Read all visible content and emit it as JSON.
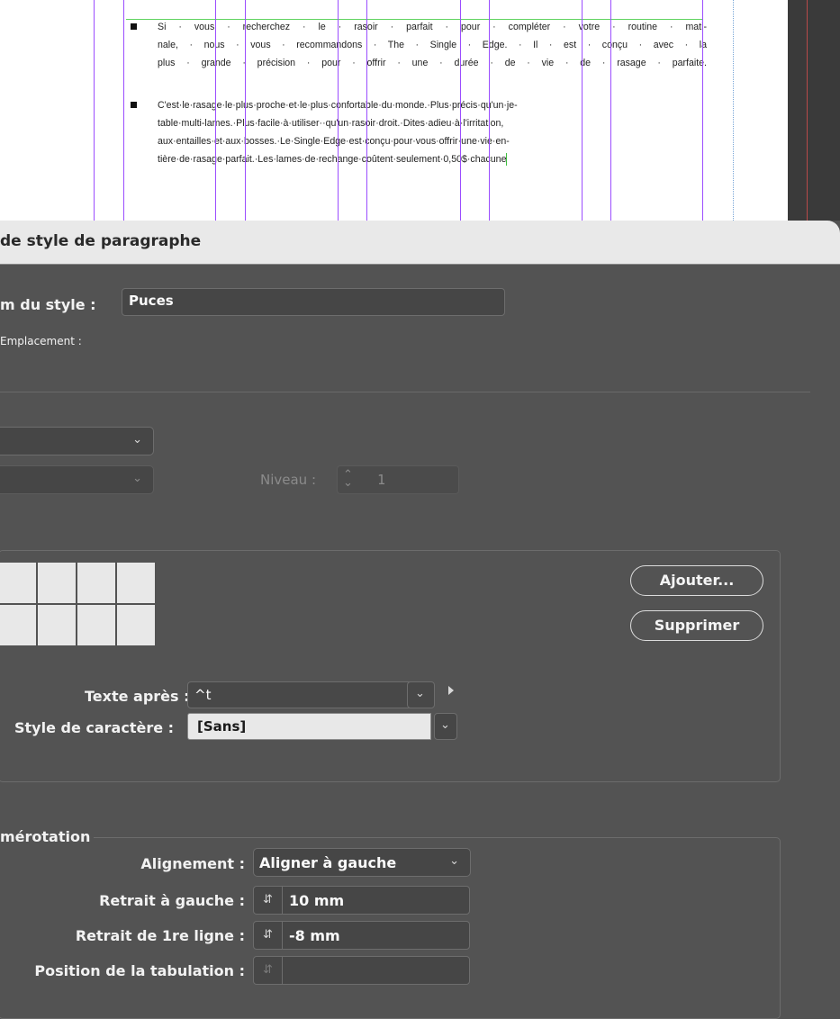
{
  "document": {
    "bullet_paragraphs": [
      {
        "lines": [
          "Si · vous · recherchez · le · rasoir · parfait · pour · compléter · votre · routine · mati-",
          "nale, · nous · vous · recommandons · The · Single · Edge. · Il · est · conçu · avec · la",
          "plus · grande · précision · pour · offrir · une · durée · de · vie · de · rasage · parfaite."
        ]
      },
      {
        "lines": [
          "C'est·le·rasage·le·plus·proche·et·le·plus·confortable·du·monde.·Plus·précis·qu'un·je-",
          "table·multi-lames.·Plus·facile·à·utiliser··qu'un·rasoir·droit.·Dites·adieu·à·l'irritation,",
          "aux·entailles·et·aux·bosses.·Le·Single·Edge·est·conçu·pour·vous·offrir·une·vie·en-",
          "tière·de·rasage·parfait.·Les·lames·de·rechange·coûtent·seulement·0,50$·chacune"
        ]
      }
    ]
  },
  "dialog": {
    "title": "de style de paragraphe",
    "style_name_label": "m du style :",
    "style_name_value": "Puces",
    "location_label": "Emplacement :",
    "niveau_label": "Niveau :",
    "niveau_value": "1",
    "add_button": "Ajouter...",
    "delete_button": "Supprimer",
    "text_after_label": "Texte après :",
    "text_after_value": "^t",
    "char_style_label": "Style de caractère :",
    "char_style_value": "[Sans]",
    "numbering_legend": "mérotation",
    "alignment_label": "Alignement :",
    "alignment_value": "Aligner à gauche",
    "left_indent_label": "Retrait à gauche :",
    "left_indent_value": "10 mm",
    "first_line_label": "Retrait de 1re ligne :",
    "first_line_value": "-8 mm",
    "tab_position_label": "Position de la tabulation :",
    "tab_position_value": ""
  },
  "colors": {
    "panel_bg": "#535353",
    "titlebar_bg": "#e9e9e9",
    "column_guide": "#9b4dff",
    "margin_guide": "#5fd35f"
  }
}
